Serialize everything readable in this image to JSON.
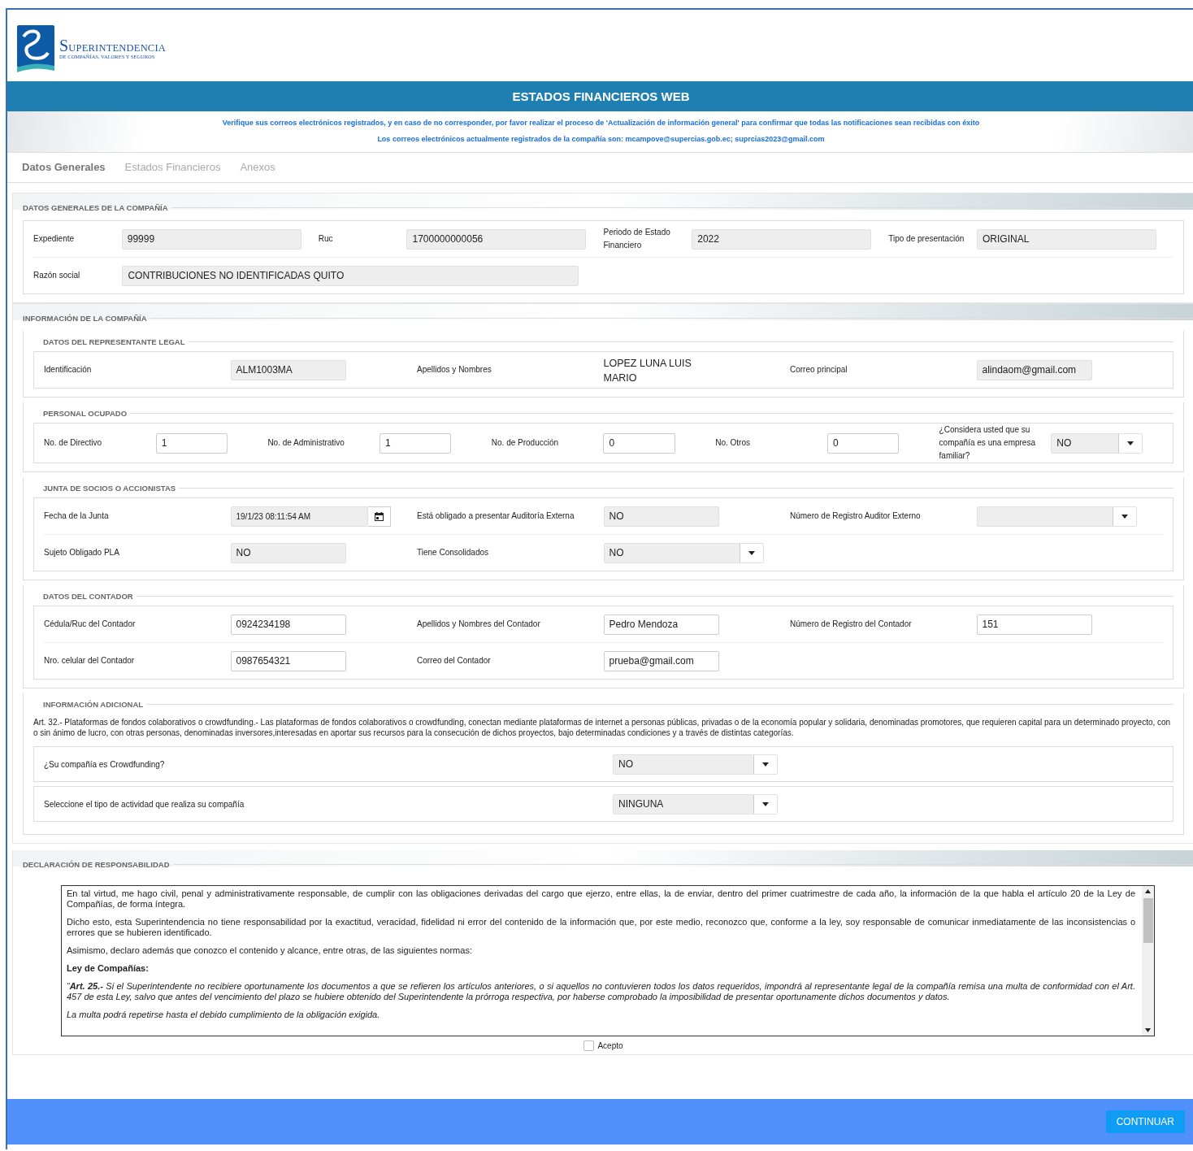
{
  "header": {
    "brand": "SUPERINTENDENCIA",
    "brand_sub": "DE COMPAÑÍAS, VALORES Y SEGUROS"
  },
  "banner": {
    "title": "ESTADOS FINANCIEROS WEB"
  },
  "notices": [
    "Verifique sus correos electrónicos registrados, y en caso de no corresponder, por favor realizar el proceso de 'Actualización de información general' para confirmar que todas las notificaciones sean recibidas con éxito",
    "Los correos electrónicos actualmente registrados de la compañía son: mcampove@supercias.gob.ec; suprcias2023@gmail.com"
  ],
  "tabs": [
    {
      "label": "Datos Generales",
      "selected": true
    },
    {
      "label": "Estados Financieros",
      "selected": false
    },
    {
      "label": "Anexos",
      "selected": false
    }
  ],
  "company_general": {
    "title": "DATOS GENERALES DE LA COMPAÑÍA",
    "rows": [
      [
        {
          "label": "Expediente",
          "kind": "readonly",
          "value": "99999"
        },
        {
          "label": "Ruc",
          "kind": "readonly",
          "value": "1700000000056"
        },
        {
          "label": "Periodo de Estado Financiero",
          "kind": "readonly",
          "value": "2022"
        },
        {
          "label": "Tipo de presentación",
          "kind": "readonly",
          "value": "ORIGINAL"
        }
      ],
      [
        {
          "label": "Razón social",
          "kind": "readonly",
          "value": "CONTRIBUCIONES NO IDENTIFICADAS QUITO"
        }
      ]
    ]
  },
  "company_info": {
    "title": "INFORMACIÓN DE LA COMPAÑÍA",
    "groups": [
      {
        "title": "DATOS DEL REPRESENTANTE LEGAL",
        "kind": "fields",
        "rows": [
          [
            {
              "label": "Identificación",
              "kind": "readonly",
              "value": "ALM1003MA"
            },
            {
              "label": "Apellidos y Nombres",
              "kind": "plain",
              "value": "LOPEZ LUNA LUIS MARIO"
            },
            {
              "label": "Correo principal",
              "kind": "readonly",
              "value": "alindaom@gmail.com"
            }
          ]
        ]
      },
      {
        "title": "PERSONAL OCUPADO",
        "kind": "fields",
        "rows": [
          [
            {
              "label": "No. de Directivo",
              "kind": "input",
              "value": "1"
            },
            {
              "label": "No. de Administrativo",
              "kind": "input",
              "value": "1"
            },
            {
              "label": "No. de Producción",
              "kind": "input",
              "value": "0"
            },
            {
              "label": "No. Otros",
              "kind": "input",
              "value": "0"
            },
            {
              "label": "¿Considera usted que su compañía es una empresa familiar?",
              "kind": "select",
              "value": "NO"
            }
          ]
        ]
      },
      {
        "title": "JUNTA DE SOCIOS O ACCIONISTAS",
        "kind": "fields",
        "rows": [
          [
            {
              "label": "Fecha de la Junta",
              "kind": "date",
              "value": "19/1/23 08:11:54 AM"
            },
            {
              "label": "Está obligado a presentar Auditoría Externa",
              "kind": "readonly",
              "value": "NO"
            },
            {
              "label": "Número de Registro Auditor Externo",
              "kind": "select"
            }
          ],
          [
            {
              "label": "Sujeto Obligado PLA",
              "kind": "readonly",
              "value": "NO"
            },
            {
              "label": "Tiene Consolidados",
              "kind": "select",
              "value": "NO"
            }
          ]
        ]
      },
      {
        "title": "DATOS DEL CONTADOR",
        "kind": "fields",
        "rows": [
          [
            {
              "label": "Cédula/Ruc del Contador",
              "kind": "input",
              "value": "0924234198"
            },
            {
              "label": "Apellidos y Nombres del Contador",
              "kind": "input",
              "value": "Pedro Mendoza"
            },
            {
              "label": "Número de Registro del Contador",
              "kind": "input",
              "value": "151"
            }
          ],
          [
            {
              "label": "Nro. celular del Contador",
              "kind": "input",
              "value": "0987654321"
            },
            {
              "label": "Correo del Contador",
              "kind": "input",
              "value": "prueba@gmail.com"
            }
          ]
        ]
      },
      {
        "title": "INFORMACIÓN ADICIONAL",
        "kind": "questions",
        "text": "Art. 32.- Plataformas de fondos colaborativos o crowdfunding.- Las plataformas de fondos colaborativos o crowdfunding, conectan mediante plataformas de internet a personas públicas, privadas o de la economía popular y solidaria, denominadas promotores, que requieren capital para un determinado proyecto, con o sin ánimo de lucro, con otras personas, denominadas inversores,interesadas en aportar sus recursos para la consecución de dichos proyectos, bajo determinadas condiciones y a través de distintas categorías.",
        "rows": [
          [
            {
              "label": "¿Su compañía es Crowdfunding?",
              "kind": "select",
              "value": "NO"
            }
          ],
          [
            {
              "label": "Seleccione el tipo de actividad que realiza su compañía",
              "kind": "select",
              "value": "NINGUNA"
            }
          ]
        ]
      }
    ]
  },
  "declaration": {
    "title": "DECLARACIÓN DE RESPONSABILIDAD",
    "paragraphs": [
      {
        "kind": "text",
        "text": "En tal virtud, me hago civil, penal y administrativamente responsable, de cumplir con las obligaciones derivadas del cargo que ejerzo, entre ellas, la de enviar, dentro del primer cuatrimestre de cada año, la información de la que habla el artículo 20 de la Ley de Compañías, de forma íntegra."
      },
      {
        "kind": "text",
        "text": "Dicho esto, esta Superintendencia no tiene responsabilidad por la exactitud, veracidad, fidelidad ni error del contenido de la información que, por este medio, reconozco que, conforme a la ley, soy responsable de comunicar inmediatamente de las inconsistencias o errores que se hubieren identificado."
      },
      {
        "kind": "text",
        "text": "Asimismo, declaro además que conozco el contenido y alcance, entre otras, de las siguientes normas:"
      },
      {
        "kind": "heading",
        "text": "Ley de Compañías:"
      },
      {
        "kind": "quote",
        "text": "“**Art. 25.-** Si el Superintendente no recibiere oportunamente los documentos a que se refieren los artículos anteriores, o si aquellos no contuvieren todos los datos requeridos, impondrá al representante legal de la compañía remisa una multa de conformidad con el Art. 457 de esta Ley, salvo que antes del vencimiento del plazo se hubiere obtenido del Superintendente la prórroga respectiva, por haberse comprobado la imposibilidad de presentar oportunamente dichos documentos y datos."
      },
      {
        "kind": "quote",
        "text": "La multa podrá repetirse hasta el debido cumplimiento de la obligación exigida."
      }
    ],
    "accept": {
      "label": "Acepto",
      "checked": false
    }
  },
  "continue_button": "CONTINUAR"
}
